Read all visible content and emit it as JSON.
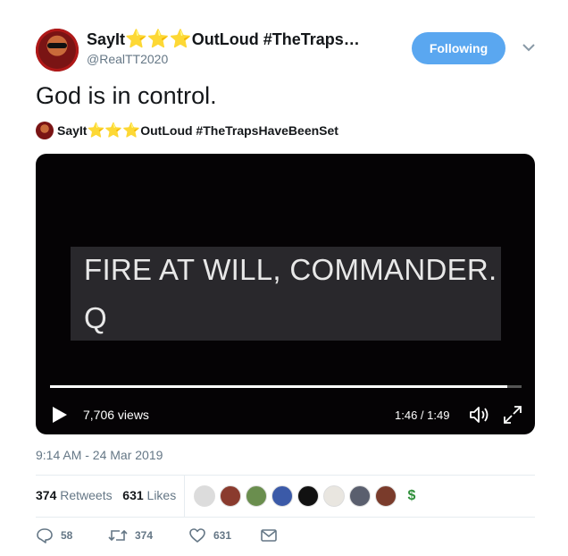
{
  "author": {
    "display_name_pre": "SayIt",
    "display_name_stars": "⭐⭐⭐",
    "display_name_post": "OutLoud #TheTraps…",
    "handle": "@RealTT2020",
    "follow_label": "Following"
  },
  "tweet": {
    "text": "God is in control.",
    "quoted_name_pre": "SayIt",
    "quoted_name_stars": "⭐⭐⭐",
    "quoted_name_post": "OutLoud #TheTrapsHaveBeenSet"
  },
  "video": {
    "caption_line1": "FIRE AT WILL, COMMANDER.",
    "caption_line2": "Q",
    "views": "7,706 views",
    "time": "1:46 / 1:49",
    "progress": 0.97
  },
  "timestamp": "9:14 AM - 24 Mar 2019",
  "stats": {
    "retweets_count": "374",
    "retweets_label": "Retweets",
    "likes_count": "631",
    "likes_label": "Likes"
  },
  "likers": [
    "#dcdcdc",
    "#8a3b2e",
    "#6a8e4e",
    "#3b5aa8",
    "#111111",
    "#e9e6e0",
    "#5a5f6e",
    "#7a3b2b",
    "#ffffff"
  ],
  "actions": {
    "replies": "58",
    "retweets": "374",
    "likes": "631"
  },
  "colors": {
    "accent": "#5aa7f0",
    "text_secondary": "#657786"
  }
}
